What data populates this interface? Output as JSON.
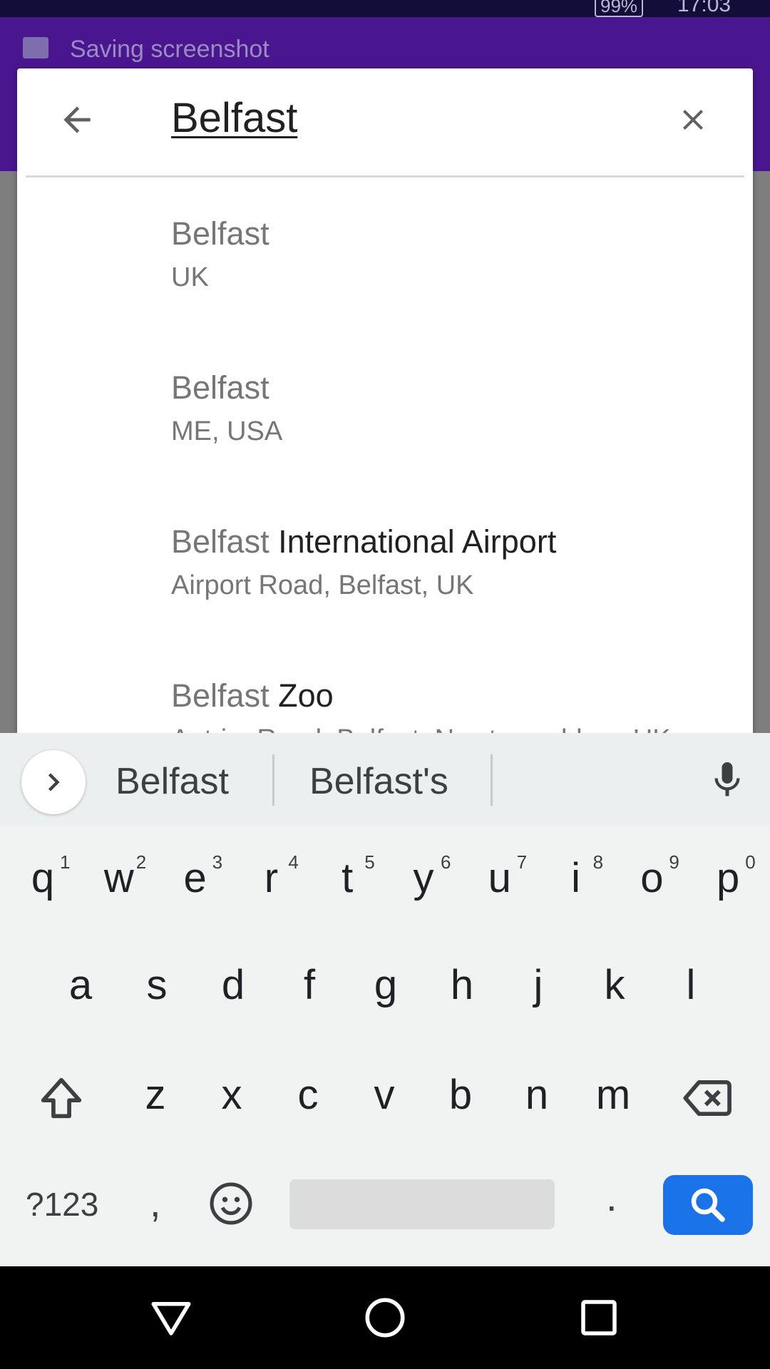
{
  "status_bar": {
    "clock": "17:03",
    "battery": "99%"
  },
  "notification": {
    "text": "Saving screenshot"
  },
  "search": {
    "query": "Belfast"
  },
  "results": [
    {
      "match": "Belfast",
      "rest": "",
      "subtitle": "UK"
    },
    {
      "match": "Belfast",
      "rest": "",
      "subtitle": "ME, USA"
    },
    {
      "match": "Belfast",
      "rest": " International Airport",
      "subtitle": "Airport Road, Belfast, UK"
    },
    {
      "match": "Belfast",
      "rest": " Zoo",
      "subtitle": "Antrim Road, Belfast, Newtownabbey, UK"
    }
  ],
  "keyboard": {
    "suggestions": [
      "Belfast",
      "Belfast's"
    ],
    "row1": [
      "q",
      "w",
      "e",
      "r",
      "t",
      "y",
      "u",
      "i",
      "o",
      "p"
    ],
    "row1_hints": [
      "1",
      "2",
      "3",
      "4",
      "5",
      "6",
      "7",
      "8",
      "9",
      "0"
    ],
    "row2": [
      "a",
      "s",
      "d",
      "f",
      "g",
      "h",
      "j",
      "k",
      "l"
    ],
    "row3": [
      "z",
      "x",
      "c",
      "v",
      "b",
      "n",
      "m"
    ],
    "symbols_key": "?123",
    "comma_key": ",",
    "period_key": "."
  },
  "colors": {
    "accent": "#1a73e8",
    "app_bar": "#4a168f",
    "status_bar": "#130d3a"
  },
  "icons": [
    "back-arrow-icon",
    "close-icon",
    "chevron-right-icon",
    "microphone-icon",
    "shift-icon",
    "backspace-icon",
    "emoji-icon",
    "search-icon",
    "nav-back-icon",
    "nav-home-icon",
    "nav-recents-icon"
  ]
}
